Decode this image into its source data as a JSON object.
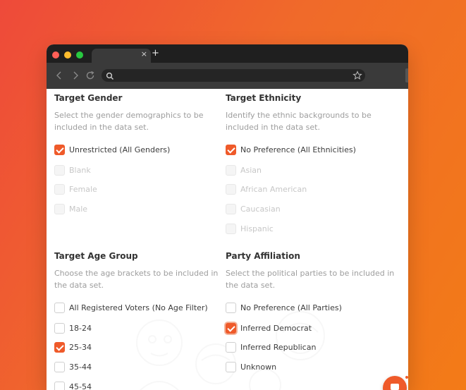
{
  "browser": {
    "tab_close": "×",
    "new_tab": "+"
  },
  "target_gender": {
    "title": "Target Gender",
    "description": "Select the gender demographics to be included in the data set.",
    "options": [
      {
        "label": "Unrestricted (All Genders)",
        "checked": true,
        "disabled": false
      },
      {
        "label": "Blank",
        "checked": false,
        "disabled": true
      },
      {
        "label": "Female",
        "checked": false,
        "disabled": true
      },
      {
        "label": "Male",
        "checked": false,
        "disabled": true
      }
    ]
  },
  "target_ethnicity": {
    "title": "Target Ethnicity",
    "description": "Identify the ethnic backgrounds to be included in the data set.",
    "options": [
      {
        "label": "No Preference (All Ethnicities)",
        "checked": true,
        "disabled": false
      },
      {
        "label": "Asian",
        "checked": false,
        "disabled": true
      },
      {
        "label": "African American",
        "checked": false,
        "disabled": true
      },
      {
        "label": "Caucasian",
        "checked": false,
        "disabled": true
      },
      {
        "label": "Hispanic",
        "checked": false,
        "disabled": true
      }
    ]
  },
  "target_age_group": {
    "title": "Target Age Group",
    "description": "Choose the age brackets to be included in the data set.",
    "options": [
      {
        "label": "All Registered Voters (No Age Filter)",
        "checked": false,
        "disabled": false
      },
      {
        "label": "18-24",
        "checked": false,
        "disabled": false
      },
      {
        "label": "25-34",
        "checked": true,
        "disabled": false
      },
      {
        "label": "35-44",
        "checked": false,
        "disabled": false
      },
      {
        "label": "45-54",
        "checked": false,
        "disabled": false
      }
    ]
  },
  "party_affiliation": {
    "title": "Party Affiliation",
    "description": "Select the political parties to be included in the data set.",
    "options": [
      {
        "label": "No Preference (All Parties)",
        "checked": false,
        "disabled": false
      },
      {
        "label": "Inferred Democrat",
        "checked": true,
        "disabled": false,
        "focused": true
      },
      {
        "label": "Inferred Republican",
        "checked": false,
        "disabled": false
      },
      {
        "label": "Unknown",
        "checked": false,
        "disabled": false
      }
    ]
  },
  "colors": {
    "accent": "#ef5a2a",
    "background_start": "#ee4a3a",
    "background_end": "#f37b17"
  }
}
